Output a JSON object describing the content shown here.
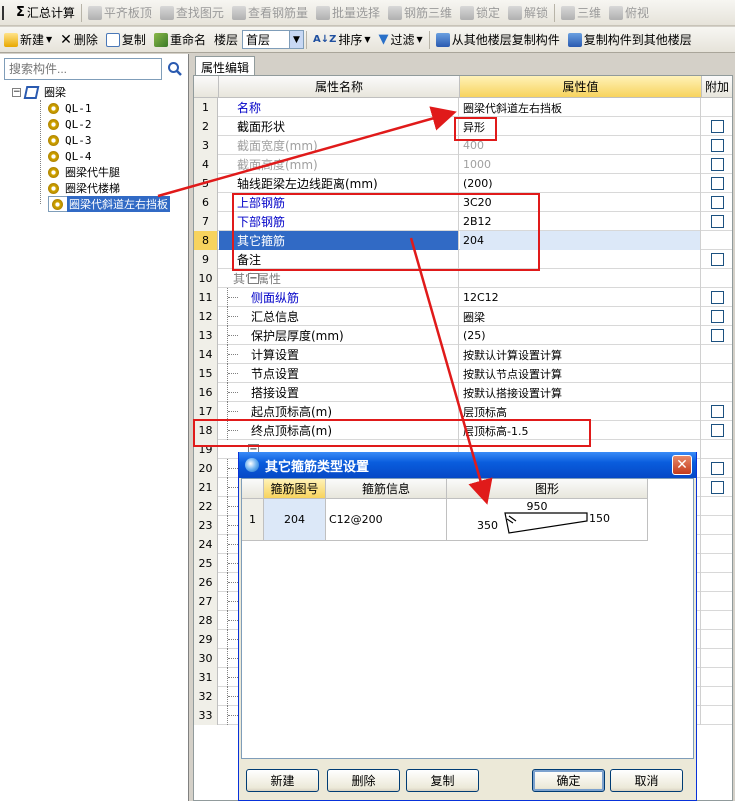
{
  "toolbar1": [
    {
      "icon": "sigma-icon",
      "label": "汇总计算",
      "enabled": true
    },
    {
      "icon": "align-top-icon",
      "label": "平齐板顶",
      "enabled": false
    },
    {
      "icon": "binoculars-icon",
      "label": "查找图元",
      "enabled": false
    },
    {
      "icon": "glasses-icon",
      "label": "查看钢筋量",
      "enabled": false
    },
    {
      "icon": "batch-select-icon",
      "label": "批量选择",
      "enabled": false
    },
    {
      "icon": "rebar-3d-icon",
      "label": "钢筋三维",
      "enabled": false
    },
    {
      "icon": "lock-icon",
      "label": "锁定",
      "enabled": false
    },
    {
      "icon": "unlock-icon",
      "label": "解锁",
      "enabled": false
    },
    {
      "icon": "3d-icon",
      "label": "三维",
      "enabled": false
    },
    {
      "icon": "top-view-icon",
      "label": "俯视",
      "enabled": false
    }
  ],
  "toolbar2": {
    "new": "新建",
    "delete": "删除",
    "copy": "复制",
    "rename": "重命名",
    "floor_label": "楼层",
    "floor_value": "首层",
    "sort": "排序",
    "filter": "过滤",
    "copy_from_floor": "从其他楼层复制构件",
    "copy_to_floor": "复制构件到其他楼层"
  },
  "left_panel": {
    "search_placeholder": "搜索构件...",
    "root": "圈梁",
    "items": [
      "QL-1",
      "QL-2",
      "QL-3",
      "QL-4",
      "圈梁代牛腿",
      "圈梁代楼梯",
      "圈梁代斜道左右挡板"
    ],
    "selected_index": 6
  },
  "property_panel": {
    "tab": "属性编辑",
    "headers": {
      "name": "属性名称",
      "value": "属性值",
      "extra": "附加"
    },
    "rows": [
      {
        "no": "1",
        "name": "名称",
        "value": "圈梁代斜道左右挡板",
        "style": "blue",
        "check": false
      },
      {
        "no": "2",
        "name": "截面形状",
        "value": "异形",
        "style": "normal",
        "check": true
      },
      {
        "no": "3",
        "name": "截面宽度(mm)",
        "value": "400",
        "style": "gray",
        "check": true
      },
      {
        "no": "4",
        "name": "截面高度(mm)",
        "value": "1000",
        "style": "gray",
        "check": true
      },
      {
        "no": "5",
        "name": "轴线距梁左边线距离(mm)",
        "value": "(200)",
        "style": "normal",
        "check": true
      },
      {
        "no": "6",
        "name": "上部钢筋",
        "value": "3C20",
        "style": "blue",
        "check": true
      },
      {
        "no": "7",
        "name": "下部钢筋",
        "value": "2B12",
        "style": "blue",
        "check": true
      },
      {
        "no": "8",
        "name": "其它箍筋",
        "value": "204",
        "style": "selected",
        "check": false
      },
      {
        "no": "9",
        "name": "备注",
        "value": "",
        "style": "normal",
        "check": true
      },
      {
        "no": "10",
        "name": "其它属性",
        "value": "",
        "style": "group",
        "check": false
      },
      {
        "no": "11",
        "name": "侧面纵筋",
        "value": "12C12",
        "style": "blue-child",
        "check": true
      },
      {
        "no": "12",
        "name": "汇总信息",
        "value": "圈梁",
        "style": "child",
        "check": true
      },
      {
        "no": "13",
        "name": "保护层厚度(mm)",
        "value": "(25)",
        "style": "child",
        "check": true
      },
      {
        "no": "14",
        "name": "计算设置",
        "value": "按默认计算设置计算",
        "style": "child",
        "check": false
      },
      {
        "no": "15",
        "name": "节点设置",
        "value": "按默认节点设置计算",
        "style": "child",
        "check": false
      },
      {
        "no": "16",
        "name": "搭接设置",
        "value": "按默认搭接设置计算",
        "style": "child",
        "check": false
      },
      {
        "no": "17",
        "name": "起点顶标高(m)",
        "value": "层顶标高",
        "style": "child",
        "check": true
      },
      {
        "no": "18",
        "name": "终点顶标高(m)",
        "value": "层顶标高-1.5",
        "style": "child",
        "check": true
      },
      {
        "no": "19",
        "name": "",
        "value": "",
        "style": "group-hidden",
        "check": false
      },
      {
        "no": "20",
        "name": "",
        "value": "",
        "style": "child",
        "check": true
      },
      {
        "no": "21",
        "name": "",
        "value": "",
        "style": "child",
        "check": true
      },
      {
        "no": "22",
        "name": "",
        "value": "",
        "style": "child",
        "check": false
      },
      {
        "no": "23",
        "name": "",
        "value": "",
        "style": "child",
        "check": false
      },
      {
        "no": "24",
        "name": "",
        "value": "",
        "style": "child",
        "check": false
      },
      {
        "no": "25",
        "name": "",
        "value": "",
        "style": "child",
        "check": false
      },
      {
        "no": "26",
        "name": "",
        "value": "",
        "style": "child",
        "check": false
      },
      {
        "no": "27",
        "name": "",
        "value": "",
        "style": "child",
        "check": false
      },
      {
        "no": "28",
        "name": "",
        "value": "",
        "style": "child",
        "check": false
      },
      {
        "no": "29",
        "name": "",
        "value": "",
        "style": "child",
        "check": false
      },
      {
        "no": "30",
        "name": "",
        "value": "",
        "style": "child",
        "check": false
      },
      {
        "no": "31",
        "name": "",
        "value": "",
        "style": "child",
        "check": false
      },
      {
        "no": "32",
        "name": "",
        "value": "",
        "style": "child",
        "check": false
      },
      {
        "no": "33",
        "name": "",
        "value": "",
        "style": "child",
        "check": false
      }
    ]
  },
  "dialog": {
    "title": "其它箍筋类型设置",
    "headers": {
      "code": "箍筋图号",
      "info": "箍筋信息",
      "shape": "图形"
    },
    "rows": [
      {
        "no": "1",
        "code": "204",
        "info": "C12@200",
        "dim_top": "950",
        "dim_left": "350",
        "dim_right": "150"
      }
    ],
    "buttons": {
      "new": "新建",
      "delete": "删除",
      "copy": "复制",
      "ok": "确定",
      "cancel": "取消"
    }
  },
  "colors": {
    "annotation_red": "#e01a1a",
    "selection_blue": "#316ac5",
    "header_gold": "#f7d35e",
    "title_blue": "#0a5ddd"
  }
}
